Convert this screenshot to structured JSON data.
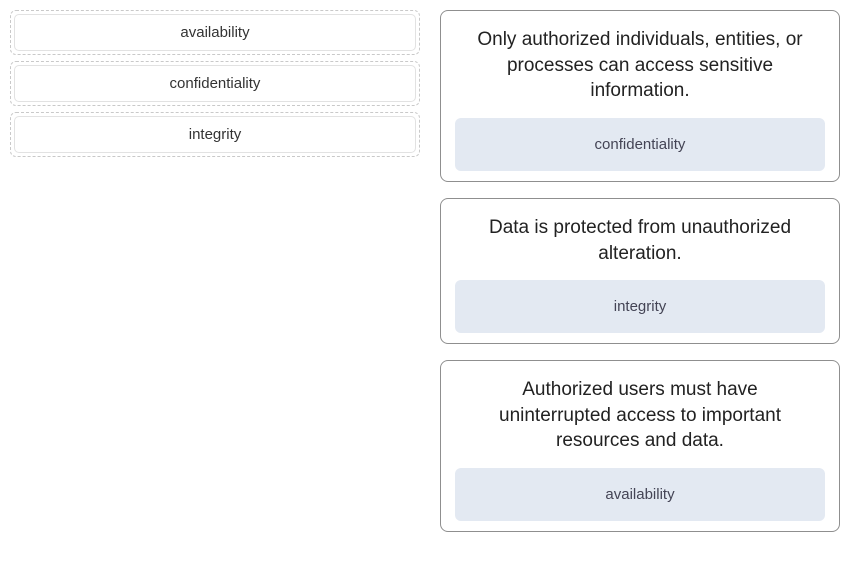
{
  "left": {
    "items": [
      {
        "label": "availability"
      },
      {
        "label": "confidentiality"
      },
      {
        "label": "integrity"
      }
    ]
  },
  "right": {
    "cards": [
      {
        "description": "Only authorized individuals, entities, or processes can access sensitive information.",
        "answer": "confidentiality"
      },
      {
        "description": "Data is protected from unauthorized alteration.",
        "answer": "integrity"
      },
      {
        "description": "Authorized users must have uninterrupted access to important resources and data.",
        "answer": "availability"
      }
    ]
  }
}
